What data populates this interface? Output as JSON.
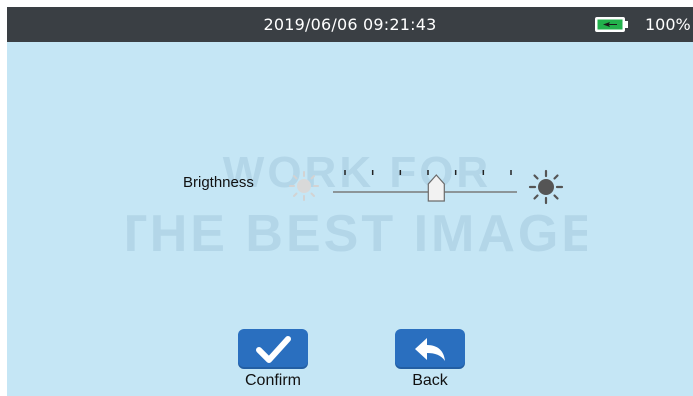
{
  "status_bar": {
    "datetime": "2019/06/06  09:21:43",
    "battery_percent": "100%",
    "battery_level": 1.0,
    "charging": true
  },
  "watermark": {
    "line1": "WORK FOR",
    "line2": "THE BEST IMAGE"
  },
  "brightness": {
    "label": "Brigthness",
    "level": 0.55,
    "tick_count": 7,
    "min_icon": "dim-sun-icon",
    "max_icon": "bright-sun-icon"
  },
  "buttons": {
    "confirm_label": "Confirm",
    "confirm_icon": "checkmark-icon",
    "back_label": "Back",
    "back_icon": "back-arrow-icon"
  },
  "colors": {
    "screen_background": "#c5e6f5",
    "status_bar": "#3a3f44",
    "button": "#2a6fbf",
    "battery_charge": "#22b14c"
  }
}
